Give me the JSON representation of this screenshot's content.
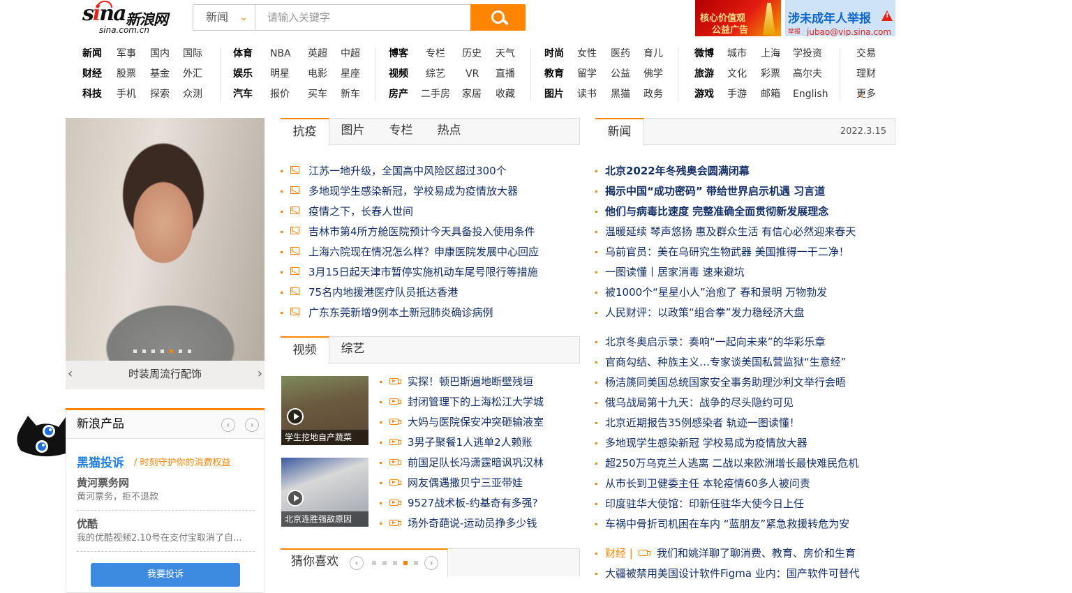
{
  "logo": {
    "brand": "sina",
    "name": "新浪网",
    "domain": "sina.com.cn"
  },
  "search": {
    "category": "新闻",
    "placeholder": "请输入关键字"
  },
  "ads": {
    "core": {
      "line1": "核心价值观",
      "line2": "公益广告"
    },
    "report": {
      "title": "涉未成年人举报",
      "tag": "举报",
      "email": "jubao@vip.sina.com"
    }
  },
  "nav": {
    "groups": [
      {
        "rows": [
          [
            "新闻",
            "军事",
            "国内",
            "国际"
          ],
          [
            "财经",
            "股票",
            "基金",
            "外汇"
          ],
          [
            "科技",
            "手机",
            "探索",
            "众测"
          ]
        ]
      },
      {
        "rows": [
          [
            "体育",
            "NBA",
            "英超",
            "中超"
          ],
          [
            "娱乐",
            "明星",
            "电影",
            "星座"
          ],
          [
            "汽车",
            "报价",
            "买车",
            "新车"
          ]
        ]
      },
      {
        "rows": [
          [
            "博客",
            "专栏",
            "历史",
            "天气"
          ],
          [
            "视频",
            "综艺",
            "VR",
            "直播"
          ],
          [
            "房产",
            "二手房",
            "家居",
            "收藏"
          ]
        ]
      },
      {
        "rows": [
          [
            "时尚",
            "女性",
            "医药",
            "育儿"
          ],
          [
            "教育",
            "留学",
            "公益",
            "佛学"
          ],
          [
            "图片",
            "读书",
            "黑猫",
            "政务"
          ]
        ]
      },
      {
        "rows": [
          [
            "微博",
            "城市",
            "上海",
            "学投资"
          ],
          [
            "旅游",
            "文化",
            "彩票",
            "高尔夫"
          ],
          [
            "游戏",
            "手游",
            "邮箱",
            "English"
          ]
        ]
      },
      {
        "rows": [
          [
            "交易"
          ],
          [
            "理财"
          ],
          [
            "更多"
          ]
        ]
      }
    ]
  },
  "carousel": {
    "caption": "时装周流行配饰",
    "prev": "‹",
    "next": "›",
    "dot_count": 7,
    "active_dot": 5
  },
  "products": {
    "title": "新浪产品",
    "brand": "黑猫投诉",
    "slogan": "/ 时刻守护你的消费权益",
    "items": [
      {
        "name": "黄河票务网",
        "desc": "黄河票务，拒不退款"
      },
      {
        "name": "优酷",
        "desc": "我的优酷视频2.10号在支付宝取消了自..."
      }
    ],
    "button": "我要投诉"
  },
  "epidemic": {
    "tabs": [
      "抗疫",
      "图片",
      "专栏",
      "热点"
    ],
    "items": [
      "江苏一地升级，全国高中风险区超过300个",
      "多地现学生感染新冠，学校易成为疫情放大器",
      "疫情之下，长春人世间",
      "吉林市第4所方舱医院预计今天具备投入使用条件",
      "上海六院现在情况怎么样？申康医院发展中心回应",
      "3月15日起天津市暂停实施机动车尾号限行等措施",
      "75名内地援港医疗队员抵达香港",
      "广东东莞新增9例本土新冠肺炎确诊病例"
    ]
  },
  "video": {
    "tabs": [
      "视频",
      "综艺"
    ],
    "thumbs": [
      "学生挖地自产蔬菜",
      "北京连胜强敌原因"
    ],
    "items": [
      "实探！顿巴斯遍地断壁残垣",
      "封闭管理下的上海松江大学城",
      "大妈与医院保安冲突砸输液室",
      "3男子聚餐1人逃单2人赖账",
      "前国足队长冯潇霆暗讽巩汉林",
      "网友偶遇撒贝宁三亚带娃",
      "9527战术板-约基奇有多强?",
      "场外奇葩说-运动员挣多少钱"
    ]
  },
  "guess": {
    "title": "猜你喜欢",
    "prev": "‹",
    "next": "›",
    "dot_count": 5,
    "active_dot": 4
  },
  "news": {
    "tab": "新闻",
    "date": "2022.3.15",
    "headlines": [
      "北京2022年冬残奥会圆满闭幕",
      "揭示中国“成功密码” 带给世界启示机遇 习言道",
      "他们与病毒比速度 完整准确全面贯彻新发展理念"
    ],
    "items1": [
      "温暖延续 琴声悠扬 惠及群众生活 有信心必然迎来春天",
      "乌前官员：美在乌研究生物武器 美国推得一干二净！",
      "一图读懂丨居家消毒 速来避坑",
      "被1000个“星星小人”治愈了 春和景明 万物勃发",
      "人民财评：以政策“组合拳”发力稳经济大盘"
    ],
    "items2": [
      "北京冬奥启示录：奏响“一起向未来”的华彩乐章",
      "官商勾结、种族主义…专家谈美国私营监狱“生意经”",
      "杨洁篪同美国总统国家安全事务助理沙利文举行会晤",
      "俄乌战局第十九天：战争的尽头隐约可见",
      "北京近期报告35例感染者 轨迹一图读懂！",
      "多地现学生感染新冠 学校易成为疫情放大器",
      "超250万乌克兰人逃离 二战以来欧洲增长最快难民危机",
      "从市长到卫健委主任 本轮疫情60多人被问责",
      "印度驻华大使馆：印新任驻华大使今日上任",
      "车祸中骨折司机困在车内 “蓝朋友”紧急救援转危为安"
    ],
    "finance": {
      "category": "财经 |",
      "text": "我们和姚洋聊了聊消费、教育、房价和生育"
    },
    "last": "大疆被禁用美国设计软件Figma 业内：国产软件可替代"
  },
  "colors": {
    "accent": "#ff8400",
    "link": "#122e67",
    "brand_blue": "#1f7fe0"
  }
}
